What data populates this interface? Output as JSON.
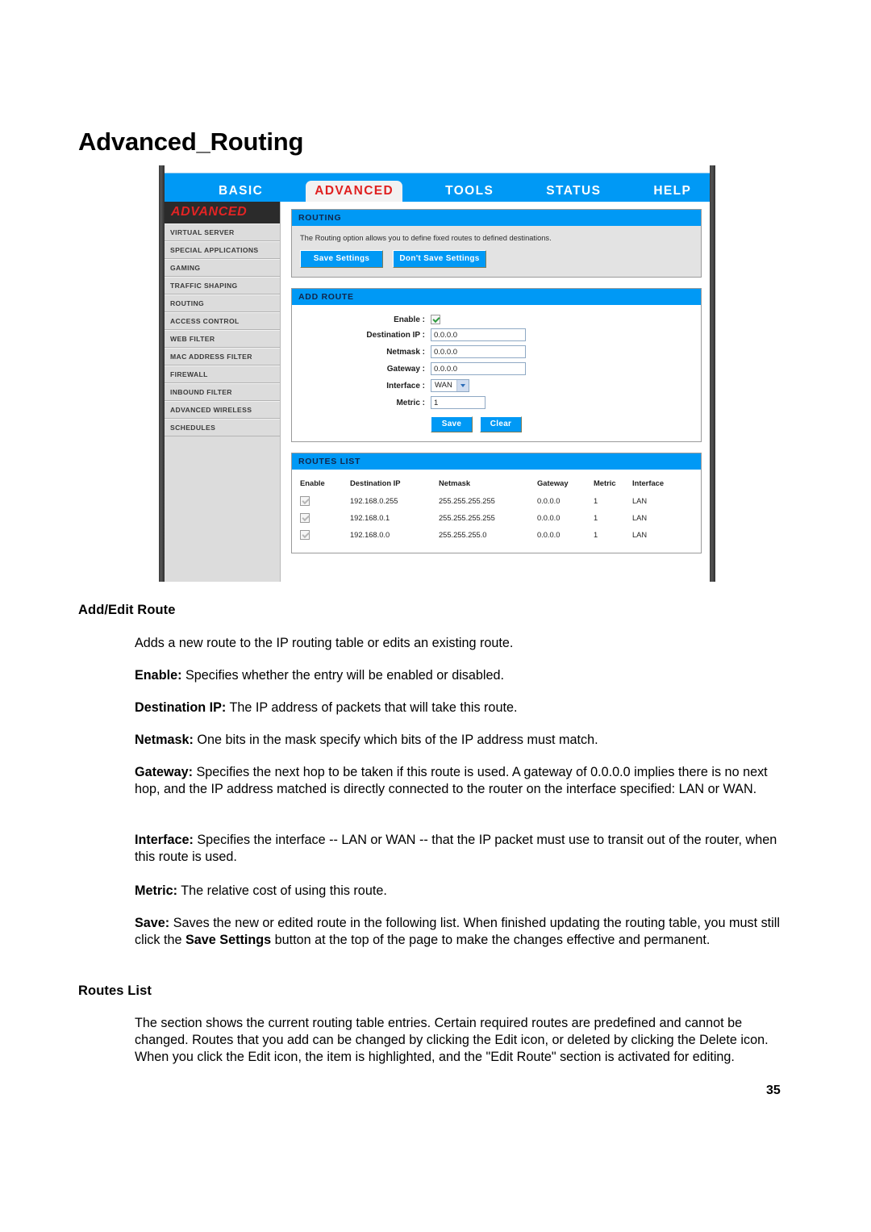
{
  "page": {
    "title": "Advanced_Routing",
    "number": "35"
  },
  "router_ui": {
    "topnav": [
      {
        "label": "BASIC",
        "active": false
      },
      {
        "label": "ADVANCED",
        "active": true
      },
      {
        "label": "TOOLS",
        "active": false
      },
      {
        "label": "STATUS",
        "active": false
      },
      {
        "label": "HELP",
        "active": false
      }
    ],
    "sidebar": {
      "header": "ADVANCED",
      "items": [
        "VIRTUAL SERVER",
        "SPECIAL APPLICATIONS",
        "GAMING",
        "TRAFFIC SHAPING",
        "ROUTING",
        "ACCESS CONTROL",
        "WEB FILTER",
        "MAC ADDRESS FILTER",
        "FIREWALL",
        "INBOUND FILTER",
        "ADVANCED WIRELESS",
        "SCHEDULES"
      ]
    },
    "routing_panel": {
      "title": "ROUTING",
      "description": "The Routing option allows you to define fixed routes to defined destinations.",
      "save_label": "Save Settings",
      "dont_save_label": "Don't Save Settings"
    },
    "add_route_panel": {
      "title": "ADD ROUTE",
      "fields": {
        "enable_label": "Enable :",
        "enable_checked": true,
        "destination_ip_label": "Destination IP :",
        "destination_ip_value": "0.0.0.0",
        "netmask_label": "Netmask :",
        "netmask_value": "0.0.0.0",
        "gateway_label": "Gateway :",
        "gateway_value": "0.0.0.0",
        "interface_label": "Interface :",
        "interface_value": "WAN",
        "interface_options": [
          "WAN",
          "LAN"
        ],
        "metric_label": "Metric :",
        "metric_value": "1"
      },
      "save_label": "Save",
      "clear_label": "Clear"
    },
    "routes_list_panel": {
      "title": "ROUTES LIST",
      "columns": [
        "Enable",
        "Destination IP",
        "Netmask",
        "Gateway",
        "Metric",
        "Interface"
      ],
      "rows": [
        {
          "enable": true,
          "destination_ip": "192.168.0.255",
          "netmask": "255.255.255.255",
          "gateway": "0.0.0.0",
          "metric": "1",
          "interface": "LAN"
        },
        {
          "enable": true,
          "destination_ip": "192.168.0.1",
          "netmask": "255.255.255.255",
          "gateway": "0.0.0.0",
          "metric": "1",
          "interface": "LAN"
        },
        {
          "enable": true,
          "destination_ip": "192.168.0.0",
          "netmask": "255.255.255.0",
          "gateway": "0.0.0.0",
          "metric": "1",
          "interface": "LAN"
        }
      ]
    },
    "colors": {
      "accent_blue": "#0099f5",
      "active_tab_text": "#e02020",
      "sidebar_header_bg": "#2b2b2b",
      "panel_gray": "#e3e3e3"
    }
  },
  "doc": {
    "section1_heading": "Add/Edit Route",
    "p_intro": "Adds a new route to the IP routing table or edits an existing route.",
    "p_enable_term": "Enable:",
    "p_enable_text": " Specifies whether the entry will be enabled or disabled.",
    "p_dest_term": "Destination IP:",
    "p_dest_text": " The IP address of packets that will take this route.",
    "p_netmask_term": "Netmask:",
    "p_netmask_text": " One bits in the mask specify which bits of the IP address must match.",
    "p_gateway_term": "Gateway:",
    "p_gateway_text": " Specifies the next hop to be taken if this route is used. A gateway of 0.0.0.0 implies there is no next hop, and the IP address matched is directly connected to the router on the interface specified: LAN or WAN.",
    "p_interface_term": "Interface:",
    "p_interface_text": " Specifies the interface -- LAN or WAN -- that the IP packet must use to transit out of the router, when this route is used.",
    "p_metric_term": "Metric:",
    "p_metric_text": " The relative cost of using this route.",
    "p_save_term": "Save:",
    "p_save_text1": " Saves the new or edited route in the following list. When finished updating the routing table, you must still click the ",
    "p_save_bold": "Save Settings",
    "p_save_text2": " button at the top of the page to make the changes effective and permanent.",
    "section2_heading": "Routes List",
    "p_routes_list": "The section shows the current routing table entries. Certain required routes are predefined and cannot be changed. Routes that you add can be changed by clicking the Edit icon, or deleted by clicking the Delete icon. When you click the Edit icon, the item is highlighted, and the \"Edit Route\" section is activated for editing."
  }
}
